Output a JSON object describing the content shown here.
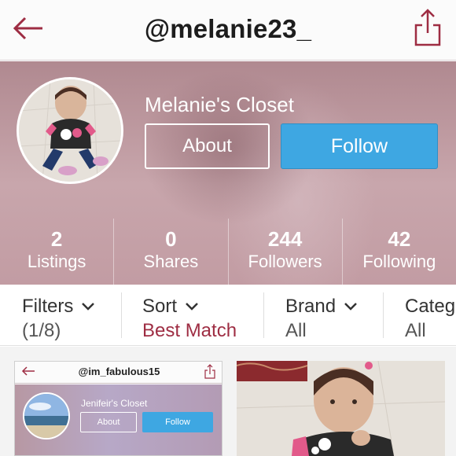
{
  "header": {
    "handle": "@melanie23_",
    "back_icon": "back-arrow-icon",
    "share_icon": "share-icon",
    "accent_color": "#9e2d43"
  },
  "profile": {
    "closet_name": "Melanie's Closet",
    "about_label": "About",
    "follow_label": "Follow",
    "follow_color": "#3ea7e2"
  },
  "stats": [
    {
      "value": "2",
      "label": "Listings"
    },
    {
      "value": "0",
      "label": "Shares"
    },
    {
      "value": "244",
      "label": "Followers"
    },
    {
      "value": "42",
      "label": "Following"
    }
  ],
  "filters": [
    {
      "title": "Filters",
      "value": "(1/8)"
    },
    {
      "title": "Sort",
      "value": "Best Match"
    },
    {
      "title": "Brand",
      "value": "All"
    },
    {
      "title": "Categ",
      "value": "All"
    }
  ],
  "listings": [
    {
      "mini_handle": "@im_fabulous15",
      "mini_closet_name": "Jenifeir's Closet",
      "mini_about": "About",
      "mini_follow": "Follow"
    },
    {
      "image": "photo of toddler"
    }
  ]
}
